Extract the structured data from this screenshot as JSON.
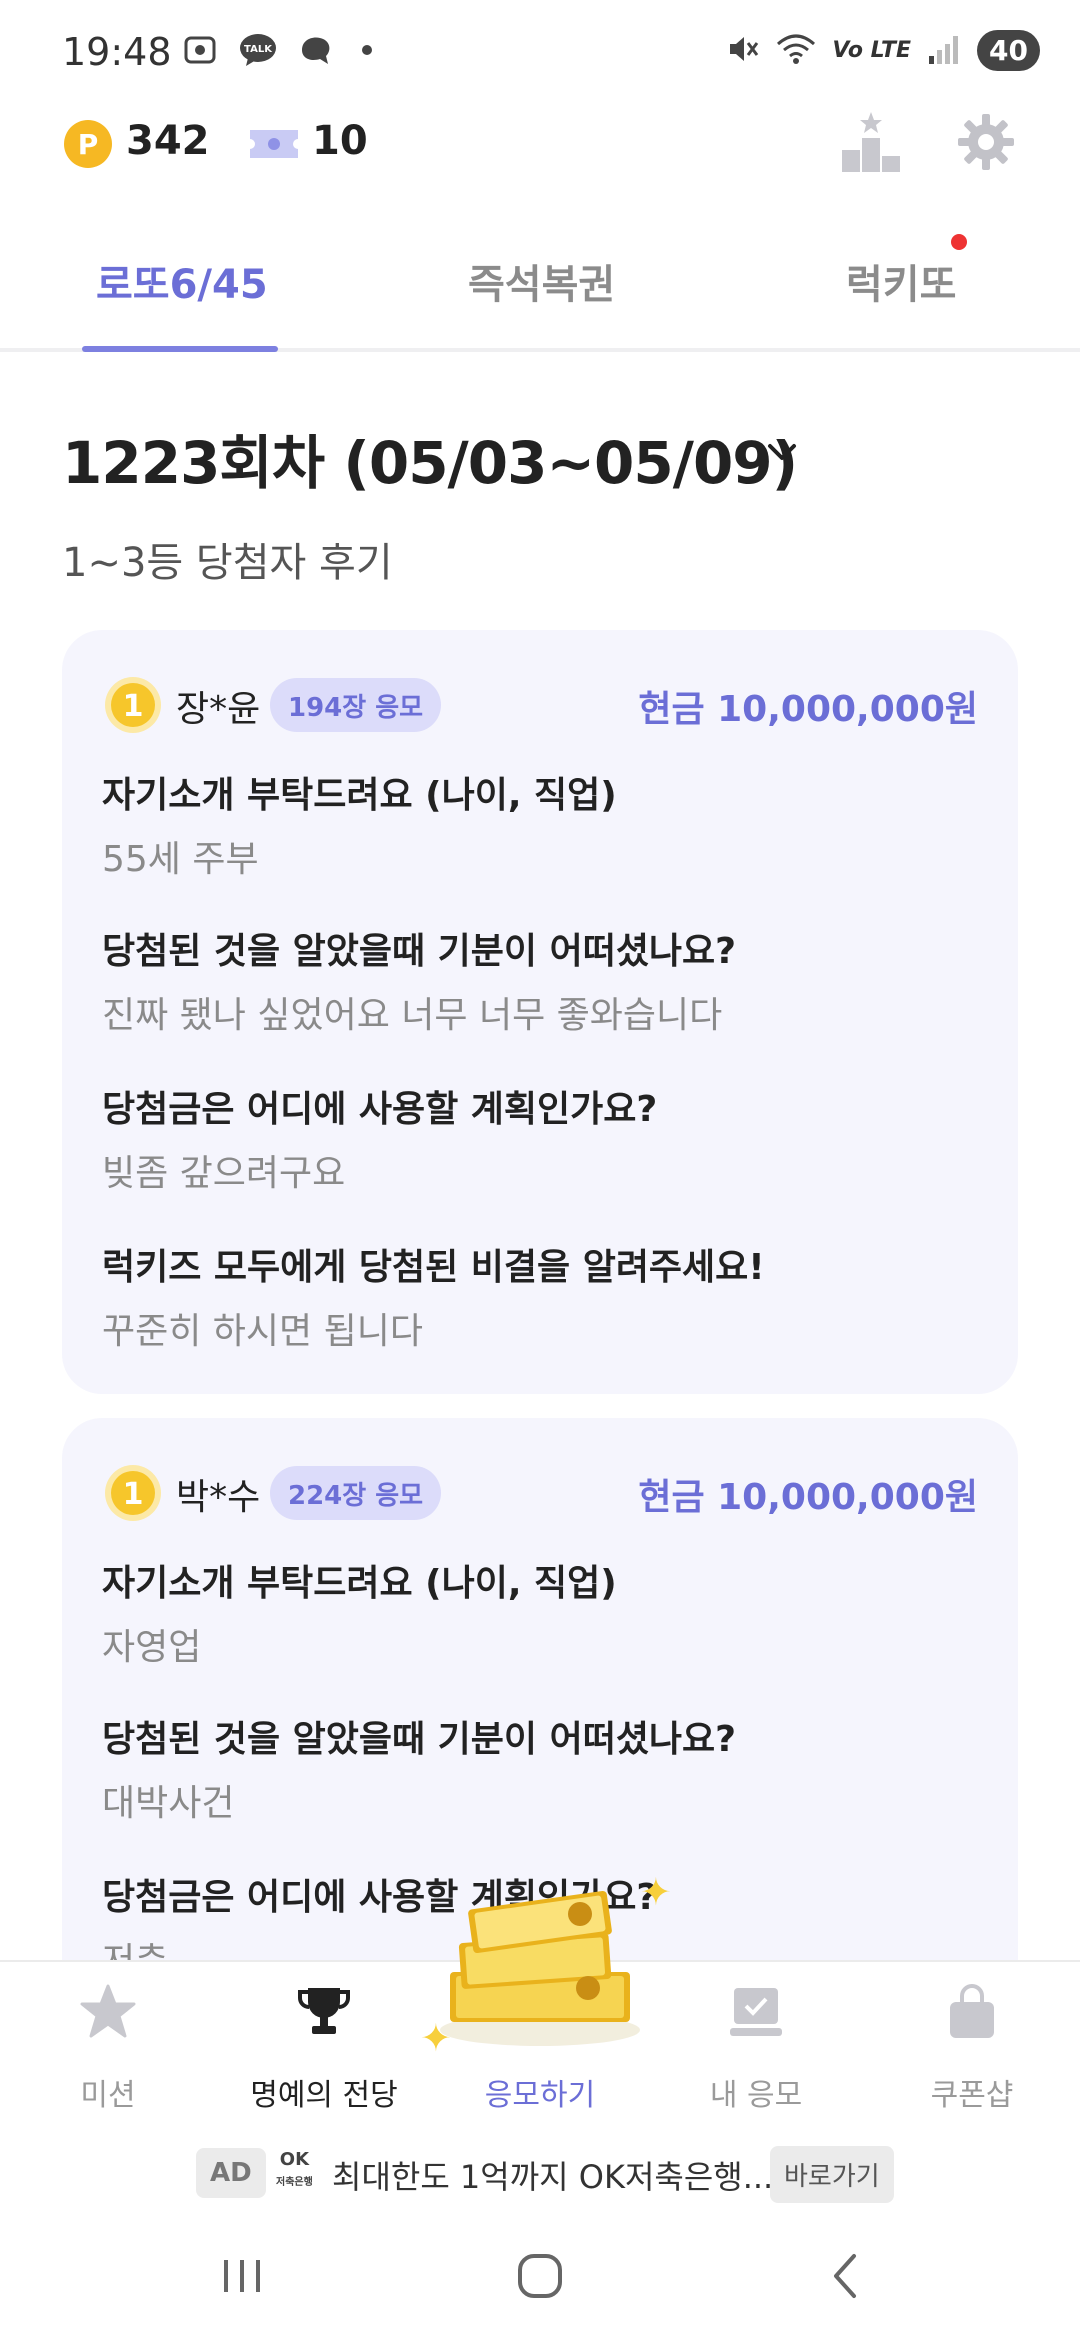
{
  "status_bar": {
    "time": "19:48",
    "talk_label": "TALK",
    "network": "Vo LTE",
    "battery": "40"
  },
  "header": {
    "points": "342",
    "point_symbol": "P",
    "tickets": "10"
  },
  "tabs": [
    {
      "label": "로또6/45",
      "active": true
    },
    {
      "label": "즉석복권",
      "active": false
    },
    {
      "label": "럭키또",
      "active": false,
      "has_notification": true
    }
  ],
  "round": {
    "title": "1223회차 (05/03~05/09)",
    "subtitle": "1~3등 당첨자 후기"
  },
  "reviews": [
    {
      "rank": "1",
      "name": "장*윤",
      "entries": "194장 응모",
      "prize": "현금 10,000,000원",
      "qa": [
        {
          "q": "자기소개 부탁드려요 (나이, 직업)",
          "a": "55세 주부"
        },
        {
          "q": "당첨된 것을 알았을때 기분이 어떠셨나요?",
          "a": "진짜 됐나 싶었어요 너무 너무 좋와습니다"
        },
        {
          "q": "당첨금은 어디에 사용할 계획인가요?",
          "a": "빚좀 갚으려구요"
        },
        {
          "q": "럭키즈 모두에게 당첨된 비결을 알려주세요!",
          "a": "꾸준히 하시면 됩니다"
        }
      ]
    },
    {
      "rank": "1",
      "name": "박*수",
      "entries": "224장 응모",
      "prize": "현금 10,000,000원",
      "qa": [
        {
          "q": "자기소개 부탁드려요 (나이, 직업)",
          "a": "자영업"
        },
        {
          "q": "당첨된 것을 알았을때 기분이 어떠셨나요?",
          "a": "대박사건"
        },
        {
          "q": "당첨금은 어디에 사용할 계획인가요?",
          "a": "저축"
        }
      ]
    }
  ],
  "bottom_nav": [
    {
      "label": "미션",
      "icon": "star-icon"
    },
    {
      "label": "명예의 전당",
      "icon": "trophy-icon"
    },
    {
      "label": "응모하기",
      "icon": "money-pile-icon"
    },
    {
      "label": "내 응모",
      "icon": "my-entry-icon"
    },
    {
      "label": "쿠폰샵",
      "icon": "shopping-bag-icon"
    }
  ],
  "ad": {
    "tag": "AD",
    "logo_text": "OK",
    "logo_sub": "저축은행",
    "text": "최대한도 1억까지 OK저축은행...",
    "cta": "바로가기"
  },
  "colors": {
    "accent": "#6b6ed6",
    "card_bg": "#f5f5fd",
    "badge_bg": "#dcdcfa",
    "point_gold": "#f6b823"
  }
}
